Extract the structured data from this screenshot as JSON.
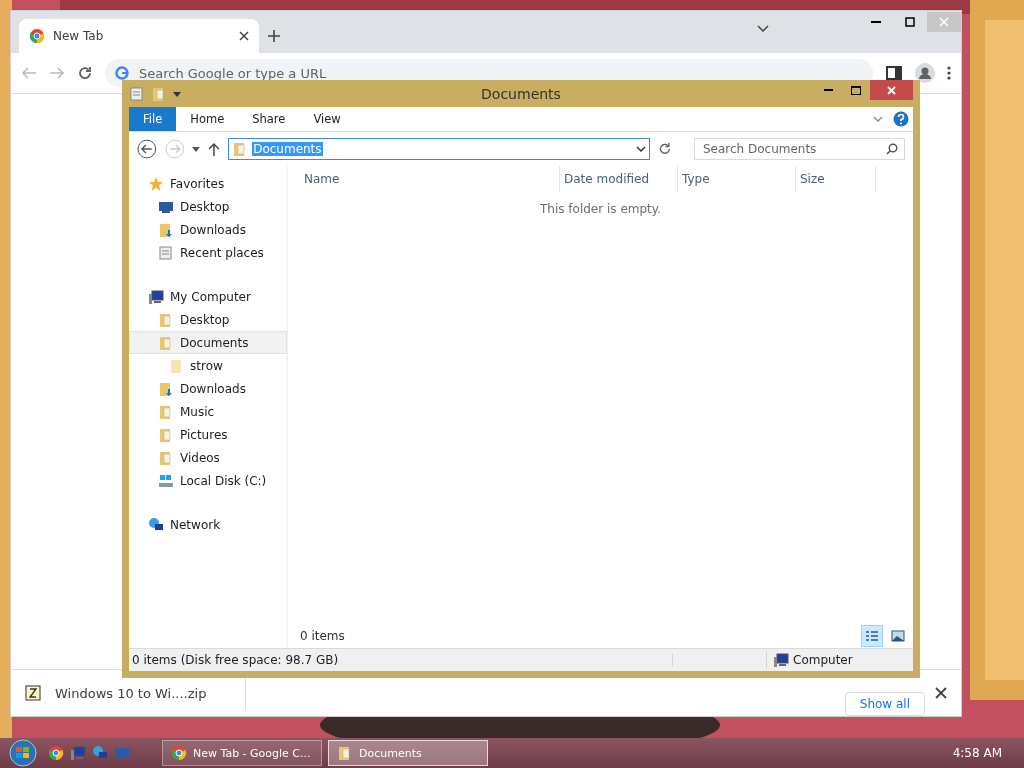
{
  "chrome": {
    "tabs": [
      {
        "title": "New Tab",
        "selected": true
      }
    ],
    "omnibox": {
      "placeholder": "Search Google or type a URL"
    },
    "download": {
      "file": "Windows 10 to Wi....zip"
    },
    "show_all": "Show all"
  },
  "explorer": {
    "title": "Documents",
    "ribbon_tabs": [
      {
        "label": "File",
        "selected": true
      },
      {
        "label": "Home",
        "selected": false
      },
      {
        "label": "Share",
        "selected": false
      },
      {
        "label": "View",
        "selected": false
      }
    ],
    "address": "Documents",
    "search": {
      "placeholder": "Search Documents"
    },
    "nav": [
      {
        "label": "Favorites",
        "kind": "star",
        "selected": false,
        "children": [
          {
            "label": "Desktop",
            "kind": "desktop",
            "selected": false
          },
          {
            "label": "Downloads",
            "kind": "downloads",
            "selected": false
          },
          {
            "label": "Recent places",
            "kind": "recent",
            "selected": false
          }
        ]
      },
      {
        "label": "My Computer",
        "kind": "computer",
        "selected": false,
        "children": [
          {
            "label": "Desktop",
            "kind": "folder",
            "selected": false
          },
          {
            "label": "Documents",
            "kind": "documents",
            "selected": true,
            "children": [
              {
                "label": "strow",
                "kind": "plainfolder",
                "selected": false
              }
            ]
          },
          {
            "label": "Downloads",
            "kind": "downloads",
            "selected": false
          },
          {
            "label": "Music",
            "kind": "folder",
            "selected": false
          },
          {
            "label": "Pictures",
            "kind": "folder",
            "selected": false
          },
          {
            "label": "Videos",
            "kind": "folder",
            "selected": false
          },
          {
            "label": "Local Disk (C:)",
            "kind": "disk",
            "selected": false
          }
        ]
      },
      {
        "label": "Network",
        "kind": "network",
        "selected": false
      }
    ],
    "columns": [
      "Name",
      "Date modified",
      "Type",
      "Size"
    ],
    "empty_message": "This folder is empty.",
    "item_count": "0 items",
    "status": "0 items (Disk free space: 98.7 GB)",
    "status_location": "Computer"
  },
  "taskbar": {
    "tasks": [
      {
        "label": "New Tab - Google C...",
        "kind": "browser",
        "selected": false
      },
      {
        "label": "Documents",
        "kind": "folder",
        "selected": true
      }
    ],
    "clock": "4:58 AM"
  }
}
